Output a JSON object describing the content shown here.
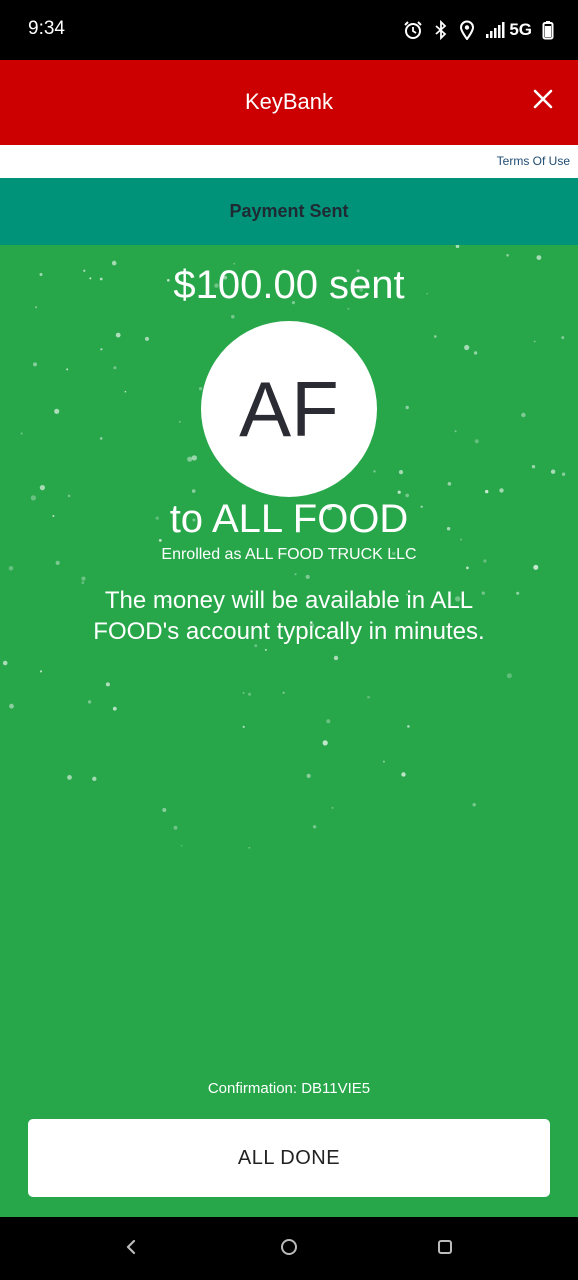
{
  "status_bar": {
    "time": "9:34",
    "network": "5G",
    "icons": [
      "alarm-icon",
      "bluetooth-icon",
      "location-icon",
      "signal-icon",
      "battery-icon"
    ]
  },
  "header": {
    "title": "KeyBank",
    "close_icon": "close-icon"
  },
  "terms": {
    "label": "Terms Of Use"
  },
  "section": {
    "title": "Payment Sent"
  },
  "payment": {
    "amount_text": "$100.00 sent",
    "avatar_initials": "AF",
    "recipient_text": "to ALL FOOD",
    "enrolled_text": "Enrolled as ALL FOOD TRUCK LLC",
    "message": "The money will be available in ALL FOOD's account typically in minutes.",
    "confirmation": "Confirmation: DB11VIE5"
  },
  "actions": {
    "done_label": "ALL DONE"
  },
  "nav": {
    "back_icon": "back-icon",
    "home_icon": "home-icon",
    "recents_icon": "recents-icon"
  },
  "colors": {
    "header_red": "#cc0000",
    "section_teal": "#00937a",
    "success_green": "#27a74a"
  }
}
